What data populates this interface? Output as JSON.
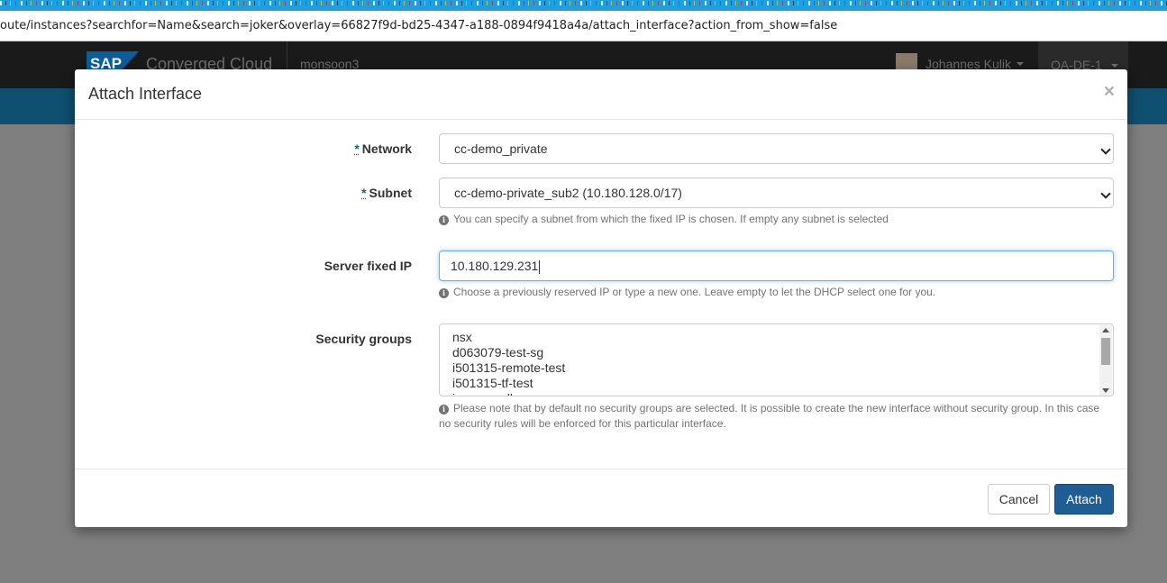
{
  "browser": {
    "url": "oute/instances?searchfor=Name&search=joker&overlay=66827f9d-bd25-4347-a188-0894f9418a4a/attach_interface?action_from_show=false"
  },
  "navbar": {
    "brand_logo": "SAP",
    "brand_name": "Converged Cloud",
    "project": "monsoon3",
    "user_name": "Johannes Kulik",
    "region": "QA-DE-1"
  },
  "modal": {
    "title": "Attach Interface",
    "close_symbol": "×",
    "required_marker": "*",
    "network": {
      "label": "Network",
      "selected": "cc-demo_private"
    },
    "subnet": {
      "label": "Subnet",
      "selected": "cc-demo-private_sub2 (10.180.128.0/17)",
      "help": "You can specify a subnet from which the fixed IP is chosen. If empty any subnet is selected"
    },
    "fixed_ip": {
      "label": "Server fixed IP",
      "value": "10.180.129.231",
      "help": "Choose a previously reserved IP or type a new one. Leave empty to let the DHCP select one for you."
    },
    "security_groups": {
      "label": "Security groups",
      "options": [
        "nsx",
        "d063079-test-sg",
        "i501315-remote-test",
        "i501315-tf-test",
        "ingress_all"
      ],
      "help": "Please note that by default no security groups are selected. It is possible to create the new interface without security group. In this case no security rules will be enforced for this particular interface."
    },
    "buttons": {
      "cancel": "Cancel",
      "attach": "Attach"
    }
  },
  "colors": {
    "primary": "#1e5e94",
    "navbar": "#1a1a1a",
    "backdrop": "#7f7f7f"
  }
}
